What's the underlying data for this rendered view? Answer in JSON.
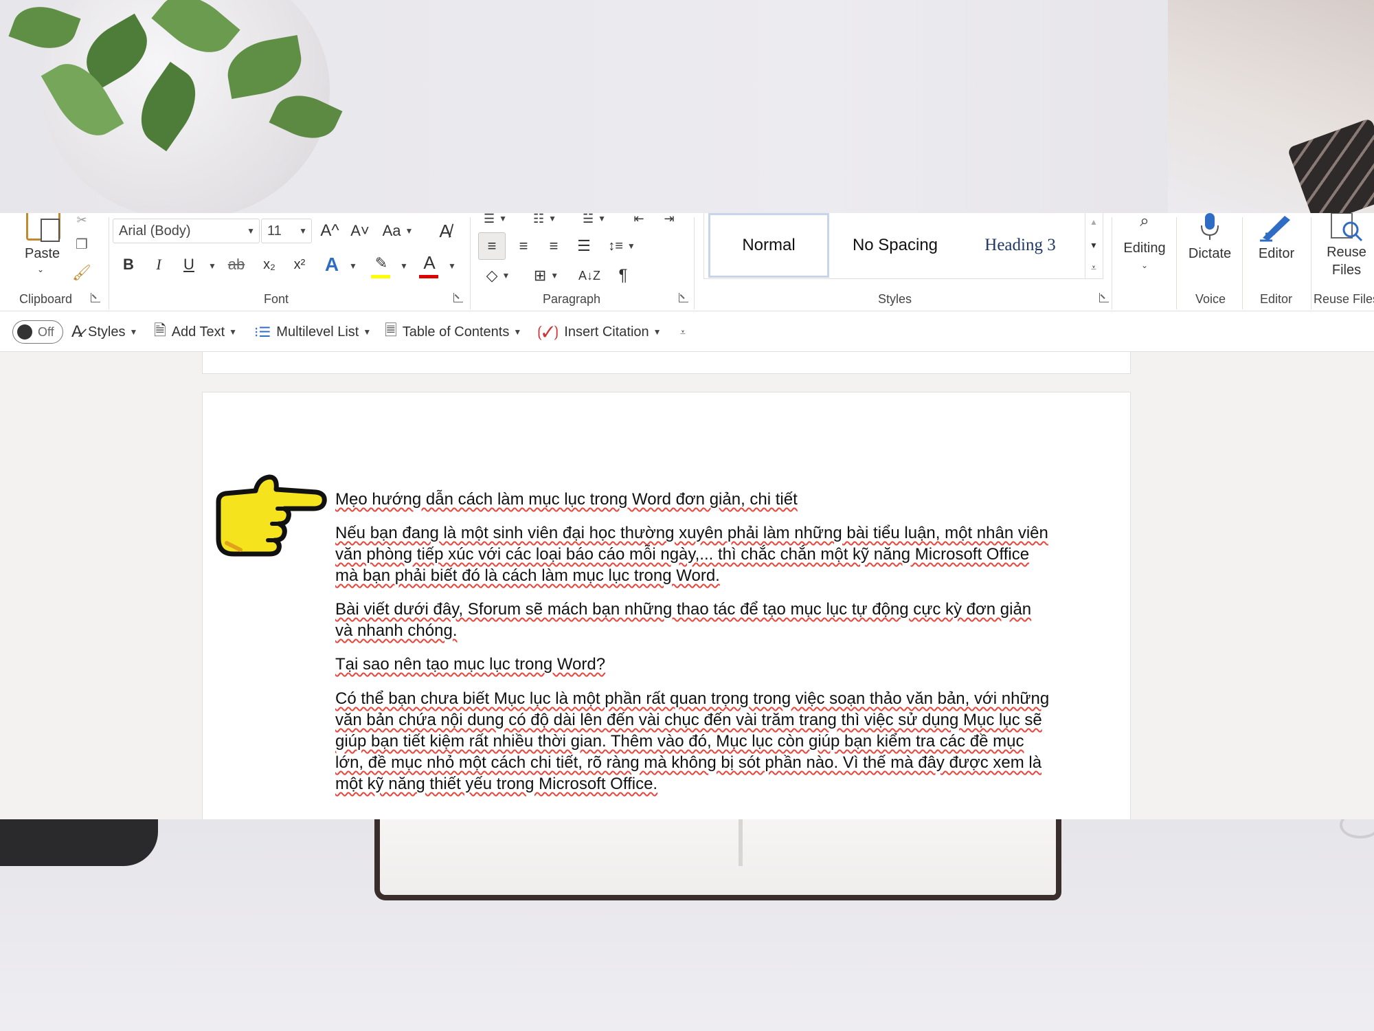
{
  "ribbon": {
    "clipboard": {
      "paste_label": "Paste",
      "group_label": "Clipboard"
    },
    "font": {
      "font_name": "Arial (Body)",
      "font_size": "11",
      "grow_font": "A^",
      "shrink_font": "A˅",
      "change_case": "Aa",
      "bold": "B",
      "italic": "I",
      "underline": "U",
      "strikethrough": "ab",
      "subscript": "x₂",
      "superscript": "x²",
      "text_effects": "A",
      "font_color": "A",
      "group_label": "Font",
      "highlight_color": "#ffff00",
      "font_color_value": "#e00000"
    },
    "paragraph": {
      "group_label": "Paragraph",
      "show_marks": "¶"
    },
    "styles": {
      "group_label": "Styles",
      "items": [
        "Normal",
        "No Spacing",
        "Heading 3"
      ]
    },
    "editing": {
      "label": "Editing"
    },
    "voice": {
      "dictate_label": "Dictate",
      "group_label": "Voice"
    },
    "editor": {
      "label": "Editor",
      "group_label": "Editor"
    },
    "reuse": {
      "label_line1": "Reuse",
      "label_line2": "Files",
      "group_label": "Reuse Files"
    }
  },
  "qat": {
    "toggle_label": "Off",
    "styles_label": "Styles",
    "add_text_label": "Add Text",
    "multilevel_label": "Multilevel List",
    "toc_label": "Table of Contents",
    "citation_label": "Insert Citation"
  },
  "document": {
    "paragraphs": [
      "Mẹo hướng dẫn cách làm mục lục trong Word đơn giản, chi tiết",
      "Nếu bạn đang là một sinh viên đại học thường xuyên phải làm những bài tiểu luận, một nhân viên văn phòng tiếp xúc với các loại báo cáo mỗi ngày,... thì chắc chắn một kỹ năng Microsoft Office mà bạn phải biết đó là cách làm mục lục trong Word.",
      "Bài viết dưới đây, Sforum sẽ mách bạn những thao tác để tạo mục lục tự động cực kỳ đơn giản và nhanh chóng.",
      "Tại sao nên tạo mục lục trong Word?",
      "Có thể bạn chưa biết Mục lục là một phần rất quan trọng trong việc soạn thảo văn bản, với những văn bản chứa nội dung có độ dài lên đến vài chục đến vài trăm trang thì việc sử dụng Mục lục sẽ giúp bạn tiết kiệm rất nhiều thời gian. Thêm vào đó, Mục lục còn giúp bạn kiểm tra các đề mục lớn, đề mục nhỏ một cách chi tiết, rõ ràng mà không bị sót phần nào. Vì thế mà đây được xem là một kỹ năng thiết yếu trong Microsoft Office."
    ]
  }
}
